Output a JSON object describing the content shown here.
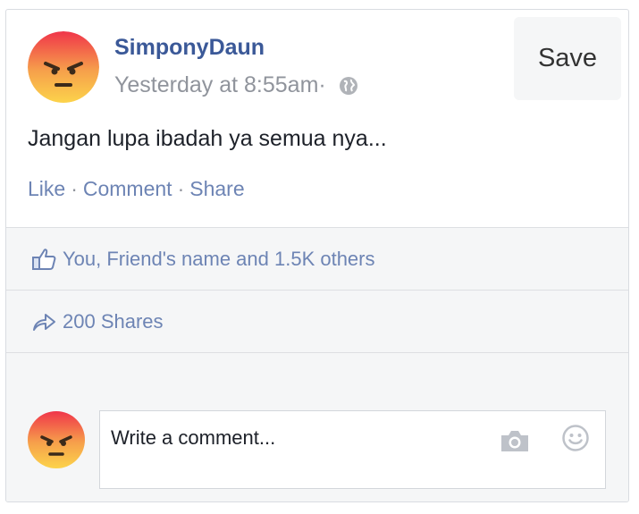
{
  "post": {
    "author": "SimponyDaun",
    "timestamp": "Yesterday at 8:55am·",
    "privacy_icon": "globe-icon",
    "text": "Jangan lupa ibadah ya semua nya...",
    "save_label": "Save"
  },
  "actions": {
    "like": "Like",
    "separator": "·",
    "comment": "Comment",
    "share": "Share"
  },
  "reactions": {
    "icon": "thumbs-up-icon",
    "summary": "You, Friend's name and 1.5K others"
  },
  "shares": {
    "icon": "share-arrow-icon",
    "summary": "200 Shares"
  },
  "comment_composer": {
    "placeholder": "Write a comment...",
    "camera_icon": "camera-icon",
    "emoji_icon": "smiley-icon"
  },
  "colors": {
    "link": "#3b5998",
    "action": "#6d84b4",
    "meta": "#90949c",
    "panel": "#f5f6f7",
    "border": "#dddfe2"
  }
}
